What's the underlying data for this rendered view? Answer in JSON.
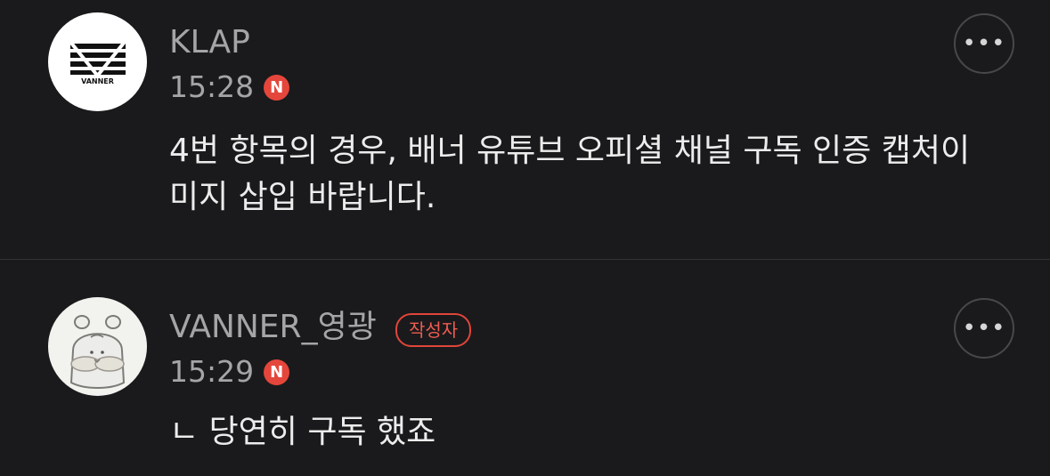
{
  "comments": [
    {
      "author": "KLAP",
      "avatar_label": "VANNER",
      "time": "15:28",
      "new_badge": "N",
      "text": "4번 항목의 경우, 배너 유튜브 오피셜 채널 구독 인증 캡처이미지 삽입 바랍니다.",
      "more_glyph": "•••"
    },
    {
      "author": "VANNER_영광",
      "author_badge": "작성자",
      "time": "15:29",
      "new_badge": "N",
      "text": "ㄴ 당연히 구독 했죠",
      "more_glyph": "•••"
    }
  ],
  "colors": {
    "background": "#1a1a1c",
    "new_badge": "#e5463b",
    "author_badge_border": "#e0453a",
    "secondary_text": "#a5a5a8"
  }
}
